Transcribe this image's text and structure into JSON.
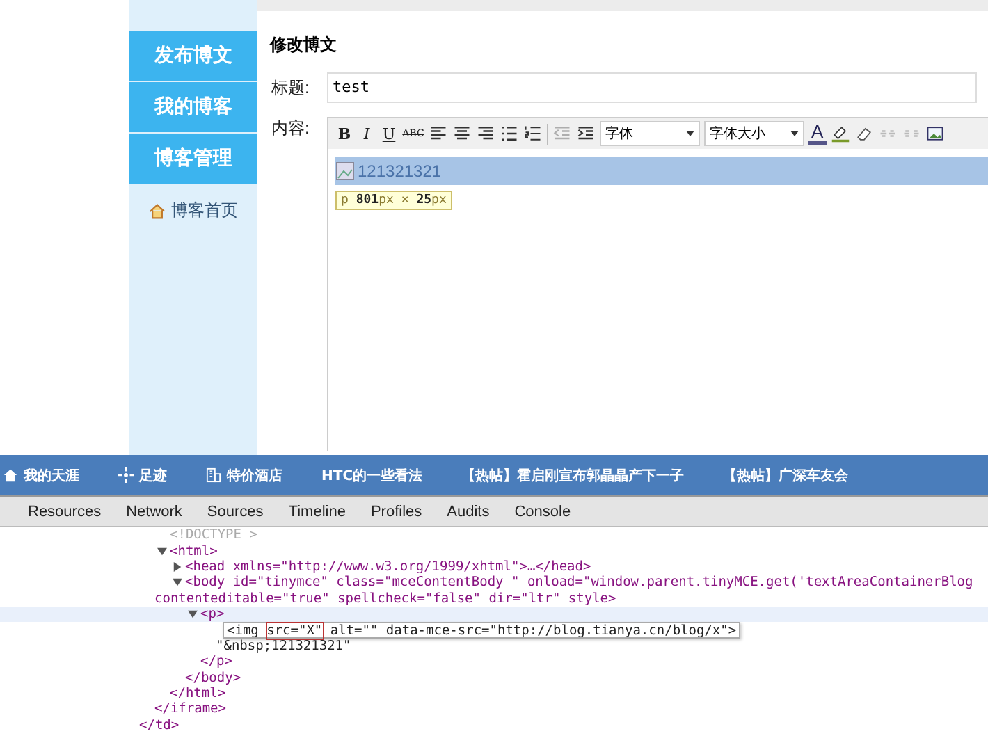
{
  "sidebar": {
    "items": [
      {
        "kind": "primary",
        "label": "发布博文"
      },
      {
        "kind": "primary",
        "label": "我的博客"
      },
      {
        "kind": "primary",
        "label": "博客管理"
      },
      {
        "kind": "link",
        "label": "博客首页"
      }
    ]
  },
  "form": {
    "heading": "修改博文",
    "title_label": "标题:",
    "title_value": "test",
    "content_label": "内容:"
  },
  "toolbar": {
    "items": [
      {
        "kind": "bold",
        "label": "B",
        "disabled": false
      },
      {
        "kind": "italic",
        "label": "I",
        "disabled": false
      },
      {
        "kind": "underline",
        "label": "U",
        "disabled": false
      },
      {
        "kind": "strike",
        "label": "ABC",
        "disabled": false
      },
      {
        "kind": "align-left",
        "disabled": false
      },
      {
        "kind": "align-center",
        "disabled": false
      },
      {
        "kind": "align-right",
        "disabled": false
      },
      {
        "kind": "bullets",
        "disabled": false
      },
      {
        "kind": "numbers",
        "disabled": false
      },
      {
        "kind": "separator"
      },
      {
        "kind": "outdent",
        "disabled": true
      },
      {
        "kind": "indent",
        "disabled": false
      },
      {
        "kind": "select",
        "label": "字体"
      },
      {
        "kind": "select",
        "label": "字体大小"
      },
      {
        "kind": "text-color",
        "label": "A",
        "disabled": false
      },
      {
        "kind": "highlight",
        "disabled": false
      },
      {
        "kind": "eraser",
        "disabled": false
      },
      {
        "kind": "link",
        "disabled": true
      },
      {
        "kind": "unlink",
        "disabled": true
      },
      {
        "kind": "image",
        "disabled": false
      }
    ]
  },
  "editor": {
    "selected_text": "121321321",
    "tooltip": "p **801**px × **25**px"
  },
  "bookmarks": [
    {
      "kind": "home",
      "label": "我的天涯"
    },
    {
      "kind": "footprint",
      "label": "足迹"
    },
    {
      "kind": "hotel",
      "label": "特价酒店"
    },
    {
      "kind": "plain",
      "label": "HTC的一些看法"
    },
    {
      "kind": "plain",
      "label": "【热帖】霍启刚宣布郭晶晶产下一子"
    },
    {
      "kind": "plain",
      "label": "【热帖】广深车友会"
    }
  ],
  "devtools_tabs": [
    "Resources",
    "Network",
    "Sources",
    "Timeline",
    "Profiles",
    "Audits",
    "Console"
  ],
  "dom_tree": [
    {
      "closing": "</td>",
      "children": [
        {
          "closing": "</iframe>",
          "children": [
            {
              "kind": "doctype",
              "text": "<!DOCTYPE >"
            },
            {
              "kind": "element",
              "text": "<html>",
              "expanded": true,
              "selected": false,
              "closing": "</html>",
              "children": [
                {
                  "kind": "element",
                  "text": "<head xmlns=\"http://www.w3.org/1999/xhtml\">…</head>",
                  "expanded": false,
                  "selected": false
                },
                {
                  "kind": "element",
                  "text": "<body id=\"tinymce\" class=\"mceContentBody \" onload=\"window.parent.tinyMCE.get('textAreaContainerBlog",
                  "continuation": "contenteditable=\"true\" spellcheck=\"false\" dir=\"ltr\" style>",
                  "expanded": true,
                  "selected": false,
                  "closing": "</body>",
                  "children": [
                    {
                      "kind": "element",
                      "text": "<p>",
                      "expanded": true,
                      "selected": true,
                      "closing": "</p>",
                      "children": [
                        {
                          "kind": "editing",
                          "parts": [
                            {
                              "text": "<img ",
                              "marked": false
                            },
                            {
                              "text": "src=\"X\"",
                              "marked": true
                            },
                            {
                              "text": " alt=\"\" data-mce-src=\"http://blog.tianya.cn/blog/x\">",
                              "marked": false
                            }
                          ]
                        },
                        {
                          "kind": "text",
                          "text": "\"&nbsp;121321321\""
                        }
                      ]
                    }
                  ]
                }
              ]
            }
          ]
        }
      ]
    }
  ]
}
